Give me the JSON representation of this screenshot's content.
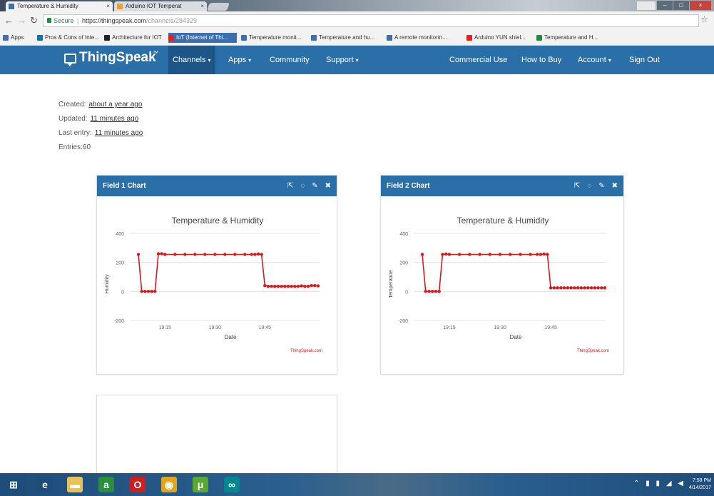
{
  "browser": {
    "tabs": [
      {
        "label": "Temperature & Humidity",
        "active": true
      },
      {
        "label": "Arduino IOT Temperat",
        "active": false
      }
    ],
    "address": {
      "secure_label": "Secure",
      "host": "https://thingspeak.com",
      "path": "/channels/284329"
    },
    "bookmarks": [
      {
        "label": "Apps",
        "icon": "apps-grid-icon",
        "color": "#4a6fa5"
      },
      {
        "label": "Pros & Cons of Inte...",
        "icon": "linkedin-icon",
        "color": "#0e76a8"
      },
      {
        "label": "Architecture for IOT",
        "icon": "medium-icon",
        "color": "#222222"
      },
      {
        "label": "IoT (Internet of Thi...",
        "icon": "youtube-icon",
        "color": "#e62117",
        "highlighted": true
      },
      {
        "label": "Temperature monit...",
        "icon": "page-icon",
        "color": "#3b6fb0"
      },
      {
        "label": "Temperature and hu...",
        "icon": "page-icon",
        "color": "#3b6fb0"
      },
      {
        "label": "A remote monitorin...",
        "icon": "page-icon",
        "color": "#3b6fb0"
      },
      {
        "label": "Arduino YUN shiel...",
        "icon": "youtube-icon",
        "color": "#e62117"
      },
      {
        "label": "Temperature and H...",
        "icon": "page-icon",
        "color": "#1e8e3e"
      }
    ]
  },
  "thingspeak": {
    "logo": "ThingSpeak",
    "logo_tm": "™",
    "nav": [
      {
        "label": "Channels",
        "caret": "▾",
        "active": true
      },
      {
        "label": "Apps",
        "caret": "▾"
      },
      {
        "label": "Community"
      },
      {
        "label": "Support",
        "caret": "▾"
      },
      {
        "label": "Commercial Use"
      },
      {
        "label": "How to Buy"
      },
      {
        "label": "Account",
        "caret": "▾"
      },
      {
        "label": "Sign Out"
      }
    ]
  },
  "channel": {
    "created_label": "Created:",
    "created_value": "about a year ago",
    "updated_label": "Updated:",
    "updated_value": "11 minutes ago",
    "last_entry_label": "Last entry:",
    "last_entry_value": "11 minutes ago",
    "entries_label": "Entries:",
    "entries_value": "60"
  },
  "widgets": [
    {
      "title": "Field 1 Chart",
      "icons": [
        "external-link-icon",
        "comment-icon",
        "pencil-icon",
        "close-icon"
      ]
    },
    {
      "title": "Field 2 Chart",
      "icons": [
        "external-link-icon",
        "comment-icon",
        "pencil-icon",
        "close-icon"
      ]
    }
  ],
  "chart_data": [
    {
      "type": "line",
      "title": "Temperature & Humidity",
      "xlabel": "Date",
      "ylabel": "Humidity",
      "yticks": [
        "400",
        "200",
        "0",
        "-200"
      ],
      "ylim": [
        -200,
        400
      ],
      "xticks": [
        "19:15",
        "19:30",
        "19:45"
      ],
      "credit": "ThingSpeak.com",
      "color": "#d7191c",
      "series": [
        {
          "x": [
            "19:07",
            "19:08",
            "19:09",
            "19:10",
            "19:11",
            "19:12",
            "19:13",
            "19:14",
            "19:15",
            "19:18",
            "19:21",
            "19:24",
            "19:27",
            "19:30",
            "19:33",
            "19:36",
            "19:39",
            "19:41",
            "19:42",
            "19:43",
            "19:44",
            "19:45",
            "19:46",
            "19:47",
            "19:48",
            "19:49",
            "19:50",
            "19:51",
            "19:52",
            "19:53",
            "19:54",
            "19:55",
            "19:56",
            "19:57",
            "19:58",
            "19:59",
            "20:00",
            "20:01"
          ],
          "y": [
            255,
            0,
            0,
            0,
            0,
            0,
            260,
            260,
            255,
            255,
            255,
            255,
            255,
            255,
            255,
            255,
            255,
            255,
            255,
            258,
            255,
            40,
            35,
            35,
            35,
            35,
            35,
            35,
            35,
            35,
            35,
            35,
            38,
            35,
            35,
            40,
            40,
            38
          ]
        }
      ]
    },
    {
      "type": "line",
      "title": "Temperature & Humidity",
      "xlabel": "Date",
      "ylabel": "Temperature",
      "yticks": [
        "400",
        "200",
        "0",
        "-200"
      ],
      "ylim": [
        -200,
        400
      ],
      "xticks": [
        "19:15",
        "19:30",
        "19:45"
      ],
      "credit": "ThingSpeak.com",
      "color": "#d7191c",
      "series": [
        {
          "x": [
            "19:07",
            "19:08",
            "19:09",
            "19:10",
            "19:11",
            "19:12",
            "19:13",
            "19:14",
            "19:15",
            "19:18",
            "19:21",
            "19:24",
            "19:27",
            "19:30",
            "19:33",
            "19:36",
            "19:39",
            "19:41",
            "19:42",
            "19:43",
            "19:44",
            "19:45",
            "19:46",
            "19:47",
            "19:48",
            "19:49",
            "19:50",
            "19:51",
            "19:52",
            "19:53",
            "19:54",
            "19:55",
            "19:56",
            "19:57",
            "19:58",
            "19:59",
            "20:00",
            "20:01"
          ],
          "y": [
            255,
            0,
            0,
            0,
            0,
            0,
            255,
            258,
            255,
            255,
            255,
            255,
            255,
            255,
            255,
            255,
            255,
            255,
            255,
            258,
            255,
            25,
            25,
            25,
            25,
            25,
            25,
            25,
            25,
            25,
            25,
            25,
            25,
            25,
            25,
            25,
            25,
            25
          ]
        }
      ]
    }
  ],
  "taskbar": {
    "apps": [
      {
        "name": "windows-start-icon",
        "color": "#1f4d7a",
        "glyph": "⊞"
      },
      {
        "name": "internet-explorer-icon",
        "color": "#1f4d7a",
        "glyph": "e"
      },
      {
        "name": "file-explorer-icon",
        "color": "#e8c15a",
        "glyph": "▬"
      },
      {
        "name": "store-icon",
        "color": "#2a8f3c",
        "glyph": "a"
      },
      {
        "name": "opera-icon",
        "color": "#cc1f1f",
        "glyph": "O"
      },
      {
        "name": "chrome-icon",
        "color": "#e0a41e",
        "glyph": "◉"
      },
      {
        "name": "utorrent-icon",
        "color": "#5aa832",
        "glyph": "μ"
      },
      {
        "name": "arduino-icon",
        "color": "#00878f",
        "glyph": "∞"
      }
    ],
    "time": "7:58 PM",
    "date": "4/14/2017"
  }
}
